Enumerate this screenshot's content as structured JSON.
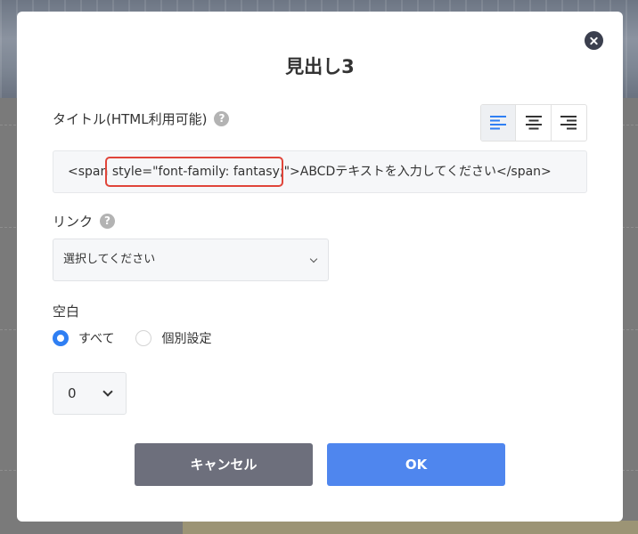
{
  "modal": {
    "title": "見出し3"
  },
  "title_field": {
    "label": "タイトル(HTML利用可能)",
    "help": "?",
    "value": "<span style=\"font-family: fantasy;\">ABCDテキストを入力してください</span>"
  },
  "alignment": {
    "options": [
      "left",
      "center",
      "right"
    ],
    "selected": "left",
    "active_color": "#2f7ff3"
  },
  "link_field": {
    "label": "リンク",
    "help": "?",
    "value": "選択してください"
  },
  "spacing": {
    "label": "空白",
    "options": [
      {
        "label": "すべて",
        "checked": true
      },
      {
        "label": "個別設定",
        "checked": false
      }
    ],
    "value": "0"
  },
  "buttons": {
    "cancel": "キャンセル",
    "ok": "OK"
  },
  "colors": {
    "accent": "#2f7ff3",
    "ok_button": "#4f86ee",
    "cancel_button": "#6d6f7c",
    "highlight": "#e0453a"
  }
}
